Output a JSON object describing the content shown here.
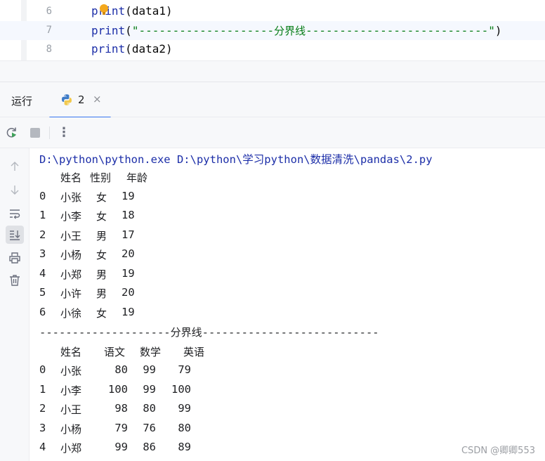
{
  "editor": {
    "lines": [
      {
        "num": "6",
        "code": {
          "fn": "print",
          "open": "(",
          "arg": "data1",
          "close": ")"
        }
      },
      {
        "num": "7",
        "code": {
          "fn": "print",
          "open": "(",
          "str_left": "\"--------------------",
          "str_mid": "分界线",
          "str_right": "---------------------------\"",
          "close": ")"
        }
      },
      {
        "num": "8",
        "code": {
          "fn": "print",
          "open": "(",
          "arg": "data2",
          "close": ")"
        }
      }
    ]
  },
  "tool_window": {
    "title": "运行",
    "tab": {
      "label": "2",
      "icon": "python-icon",
      "close_glyph": "×"
    }
  },
  "toolbar": {
    "buttons": [
      "rerun-icon",
      "stop-icon",
      "more-options-icon"
    ],
    "more_glyph": "⋮"
  },
  "side_actions": [
    "up-arrow-icon",
    "down-arrow-icon",
    "soft-wrap-icon",
    "scroll-to-end-icon",
    "print-icon",
    "trash-icon"
  ],
  "console": {
    "command": "D:\\python\\python.exe D:\\python\\学习python\\数据清洗\\pandas\\2.py",
    "table1": {
      "headers": [
        "姓名",
        "性别",
        "年龄"
      ],
      "rows": [
        {
          "idx": "0",
          "name": "小张",
          "sex": "女",
          "age": "19"
        },
        {
          "idx": "1",
          "name": "小李",
          "sex": "女",
          "age": "18"
        },
        {
          "idx": "2",
          "name": "小王",
          "sex": "男",
          "age": "17"
        },
        {
          "idx": "3",
          "name": "小杨",
          "sex": "女",
          "age": "20"
        },
        {
          "idx": "4",
          "name": "小郑",
          "sex": "男",
          "age": "19"
        },
        {
          "idx": "5",
          "name": "小许",
          "sex": "男",
          "age": "20"
        },
        {
          "idx": "6",
          "name": "小徐",
          "sex": "女",
          "age": "19"
        }
      ]
    },
    "separator": {
      "left": "--------------------",
      "mid": "分界线",
      "right": "---------------------------"
    },
    "table2": {
      "headers": [
        "姓名",
        "语文",
        "数学",
        "英语"
      ],
      "rows": [
        {
          "idx": "0",
          "name": "小张",
          "chinese": "80",
          "math": "99",
          "english": "79"
        },
        {
          "idx": "1",
          "name": "小李",
          "chinese": "100",
          "math": "99",
          "english": "100"
        },
        {
          "idx": "2",
          "name": "小王",
          "chinese": "98",
          "math": "80",
          "english": "99"
        },
        {
          "idx": "3",
          "name": "小杨",
          "chinese": "79",
          "math": "76",
          "english": "80"
        },
        {
          "idx": "4",
          "name": "小郑",
          "chinese": "99",
          "math": "86",
          "english": "89"
        }
      ]
    }
  },
  "watermark": "CSDN @卿卿553",
  "colors": {
    "accent": "#3574f0",
    "keyword": "#1c2ea8",
    "string": "#077d17",
    "bulb": "#f4a81d"
  }
}
